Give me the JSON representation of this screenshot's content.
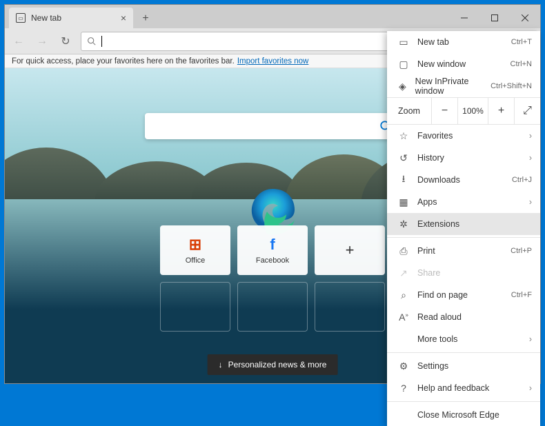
{
  "tab": {
    "title": "New tab"
  },
  "favBar": {
    "text": "For quick access, place your favorites here on the favorites bar.",
    "link": "Import favorites now"
  },
  "tiles": [
    {
      "label": "Office",
      "icon": "office"
    },
    {
      "label": "Facebook",
      "icon": "facebook"
    },
    {
      "label": "",
      "icon": "plus"
    }
  ],
  "newsBar": "Personalized news & more",
  "menu": {
    "newTab": {
      "label": "New tab",
      "shortcut": "Ctrl+T"
    },
    "newWindow": {
      "label": "New window",
      "shortcut": "Ctrl+N"
    },
    "newInPrivate": {
      "label": "New InPrivate window",
      "shortcut": "Ctrl+Shift+N"
    },
    "zoom": {
      "label": "Zoom",
      "value": "100%"
    },
    "favorites": {
      "label": "Favorites"
    },
    "history": {
      "label": "History"
    },
    "downloads": {
      "label": "Downloads",
      "shortcut": "Ctrl+J"
    },
    "apps": {
      "label": "Apps"
    },
    "extensions": {
      "label": "Extensions"
    },
    "print": {
      "label": "Print",
      "shortcut": "Ctrl+P"
    },
    "share": {
      "label": "Share"
    },
    "find": {
      "label": "Find on page",
      "shortcut": "Ctrl+F"
    },
    "readAloud": {
      "label": "Read aloud"
    },
    "moreTools": {
      "label": "More tools"
    },
    "settings": {
      "label": "Settings"
    },
    "help": {
      "label": "Help and feedback"
    },
    "close": {
      "label": "Close Microsoft Edge"
    }
  }
}
